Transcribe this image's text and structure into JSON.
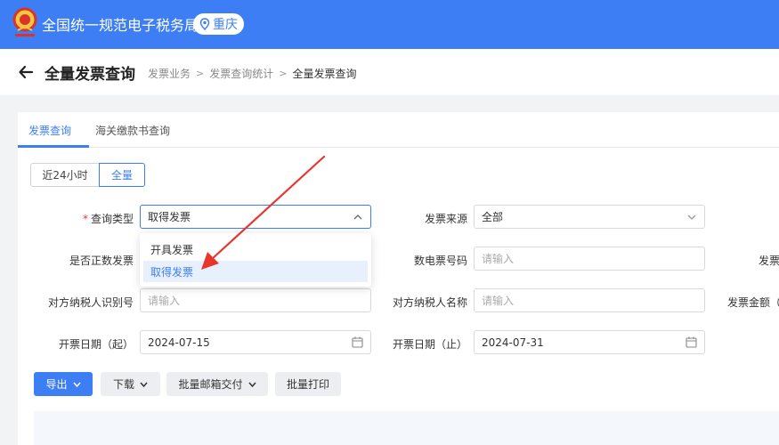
{
  "app": {
    "title": "全国统一规范电子税务局",
    "region": "重庆"
  },
  "header": {
    "page_title": "全量发票查询",
    "breadcrumb": [
      "发票业务",
      "发票查询统计",
      "全量发票查询"
    ]
  },
  "tabs": [
    {
      "label": "发票查询",
      "active": true
    },
    {
      "label": "海关缴款书查询",
      "active": false
    }
  ],
  "range_toggle": [
    {
      "label": "近24小时",
      "selected": false
    },
    {
      "label": "全量",
      "selected": true
    }
  ],
  "form": {
    "query_type": {
      "label": "查询类型",
      "required": true,
      "value": "取得发票"
    },
    "invoice_source": {
      "label": "发票来源",
      "value": "全部"
    },
    "is_positive": {
      "label": "是否正数发票"
    },
    "digital_invoice_no": {
      "label": "数电票号码",
      "placeholder": "请输入"
    },
    "invoice_status_cut": {
      "label": "发票"
    },
    "counterparty_tax_id": {
      "label": "对方纳税人识别号",
      "placeholder": "请输入"
    },
    "counterparty_name": {
      "label": "对方纳税人名称",
      "placeholder": "请输入"
    },
    "invoice_amount_cut": {
      "label": "发票金额（"
    },
    "date_from": {
      "label": "开票日期（起）",
      "value": "2024-07-15"
    },
    "date_to": {
      "label": "开票日期（止）",
      "value": "2024-07-31"
    }
  },
  "query_type_options": [
    {
      "label": "开具发票",
      "selected": false
    },
    {
      "label": "取得发票",
      "selected": true
    }
  ],
  "actions": {
    "export": "导出",
    "download": "下载",
    "batch_email": "批量邮箱交付",
    "batch_print": "批量打印"
  },
  "colors": {
    "primary": "#3d7ef5",
    "annotation_arrow": "#e8362f"
  }
}
